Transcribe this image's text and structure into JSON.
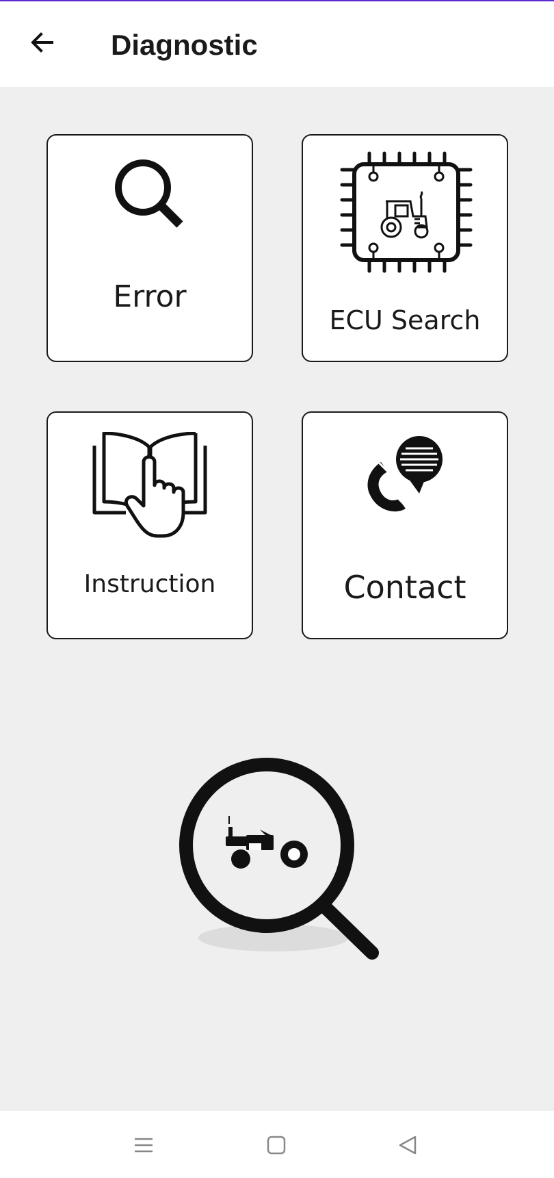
{
  "header": {
    "title": "Diagnostic",
    "back_icon": "arrow-left-icon"
  },
  "cards": [
    {
      "label": "Error",
      "icon": "magnifier-icon"
    },
    {
      "label": "ECU Search",
      "icon": "ecu-chip-tractor-icon"
    },
    {
      "label": "Instruction",
      "icon": "book-hand-icon"
    },
    {
      "label": "Contact",
      "icon": "phone-chat-icon"
    }
  ],
  "hero": {
    "icon": "tractor-search-icon"
  },
  "system_nav": {
    "icons": [
      "menu-icon",
      "home-square-icon",
      "back-triangle-icon"
    ]
  },
  "colors": {
    "accent_line": "#5b2bd1",
    "background": "#efefef",
    "card": "#ffffff"
  }
}
